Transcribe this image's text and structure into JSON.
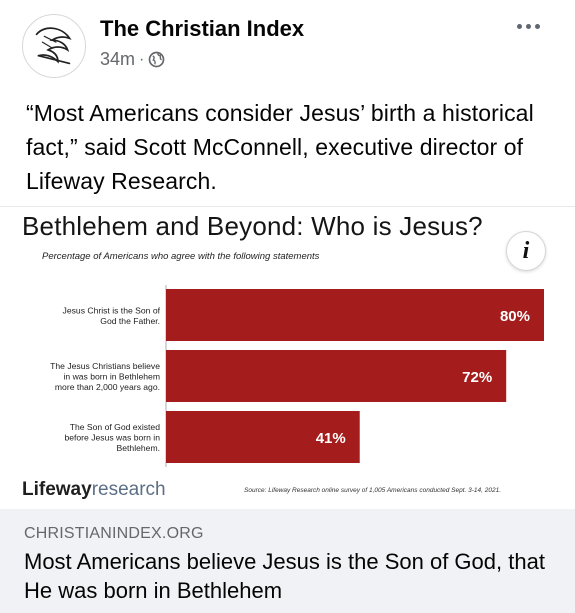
{
  "post": {
    "page_name": "The Christian Index",
    "time_ago": "34m",
    "separator": "·",
    "audience_icon": "globe-icon",
    "more_icon": "more-options-icon",
    "text": "“Most Americans consider Jesus’ birth a historical fact,” said Scott McConnell, executive director of Lifeway Research."
  },
  "chart": {
    "title": "Bethlehem and Beyond: Who is Jesus?",
    "subtitle": "Percentage of Americans who agree with the following statements",
    "info_icon": "i",
    "logo_bold": "Lifeway",
    "logo_light": "research",
    "source": "Source: Lifeway Research online survey of 1,005 Americans conducted Sept. 3-14, 2021."
  },
  "chart_data": {
    "type": "bar",
    "orientation": "horizontal",
    "categories": [
      [
        "Jesus Christ is the Son of",
        "God the Father."
      ],
      [
        "The Jesus Christians believe",
        "in was born in Bethlehem",
        "more than 2,000 years ago."
      ],
      [
        "The Son of God existed",
        "before Jesus was born in",
        "Bethlehem."
      ]
    ],
    "values": [
      80,
      72,
      41
    ],
    "value_labels": [
      "80%",
      "72%",
      "41%"
    ],
    "xlim": [
      0,
      80
    ],
    "grid": false,
    "bar_color": "#a51c1c"
  },
  "link": {
    "domain": "CHRISTIANINDEX.ORG",
    "headline": "Most Americans believe Jesus is the Son of God, that He was born in Bethlehem"
  }
}
